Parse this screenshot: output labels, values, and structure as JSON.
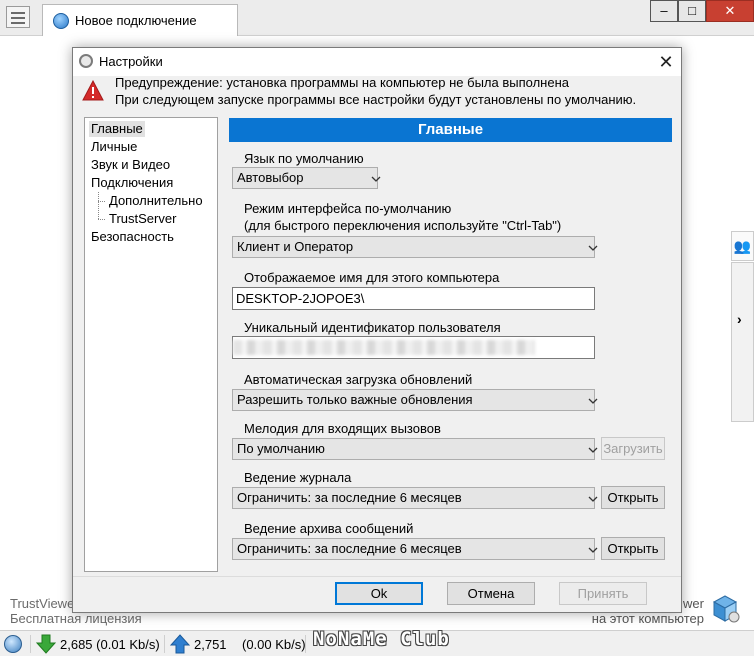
{
  "main_window": {
    "tab_title": "Новое подключение",
    "controls": {
      "minimize": "–",
      "maximize": "□",
      "close": "✕"
    },
    "brand_line1": "TrustViewer",
    "brand_line2": "Бесплатная лицензия",
    "remote_line1": "wer",
    "remote_line2": "на этот компьютер",
    "side_arrow": "›"
  },
  "status": {
    "download": "2,685 (0.01 Kb/s)",
    "upload_count": "2,751",
    "upload_rate": "(0.00 Kb/s)",
    "watermark": "NoNaMe Club"
  },
  "dialog": {
    "title": "Настройки",
    "close_glyph": "✕",
    "warning_line1": "Предупреждение: установка программы на компьютер не была выполнена",
    "warning_line2": "При следующем запуске программы все настройки будут установлены по умолчанию.",
    "nav": [
      {
        "label": "Главные",
        "selected": true
      },
      {
        "label": "Личные"
      },
      {
        "label": "Звук и Видео"
      },
      {
        "label": "Подключения"
      },
      {
        "label": "Дополнительно"
      },
      {
        "label": "TrustServer"
      },
      {
        "label": "Безопасность"
      }
    ],
    "section_title": "Главные",
    "fields": {
      "language_label": "Язык по умолчанию",
      "language_value": "Автовыбор",
      "mode_label_line1": "Режим интерфейса по-умолчанию",
      "mode_label_line2": "(для быстрого переключения используйте \"Ctrl-Tab\")",
      "mode_value": "Клиент и Оператор",
      "display_name_label": "Отображаемое имя для этого компьютера",
      "display_name_value": "DESKTOP-2JOPOE3\\",
      "uid_label": "Уникальный идентификатор пользователя",
      "updates_label": "Автоматическая загрузка обновлений",
      "updates_value": "Разрешить только важные обновления",
      "ringtone_label": "Мелодия для входящих вызовов",
      "ringtone_value": "По умолчанию",
      "ringtone_button": "Загрузить",
      "log_label": "Ведение журнала",
      "log_value": "Ограничить: за последние 6 месяцев",
      "log_button": "Открыть",
      "archive_label": "Ведение архива сообщений",
      "archive_value": "Ограничить: за последние 6 месяцев",
      "archive_button": "Открыть"
    },
    "buttons": {
      "ok": "Ok",
      "cancel": "Отмена",
      "apply": "Принять"
    }
  },
  "colors": {
    "accent": "#0a75d2",
    "close_button": "#c84031",
    "warning": "#d42a2a",
    "download_arrow": "#3aa83a",
    "upload_arrow": "#2f7fd0"
  }
}
